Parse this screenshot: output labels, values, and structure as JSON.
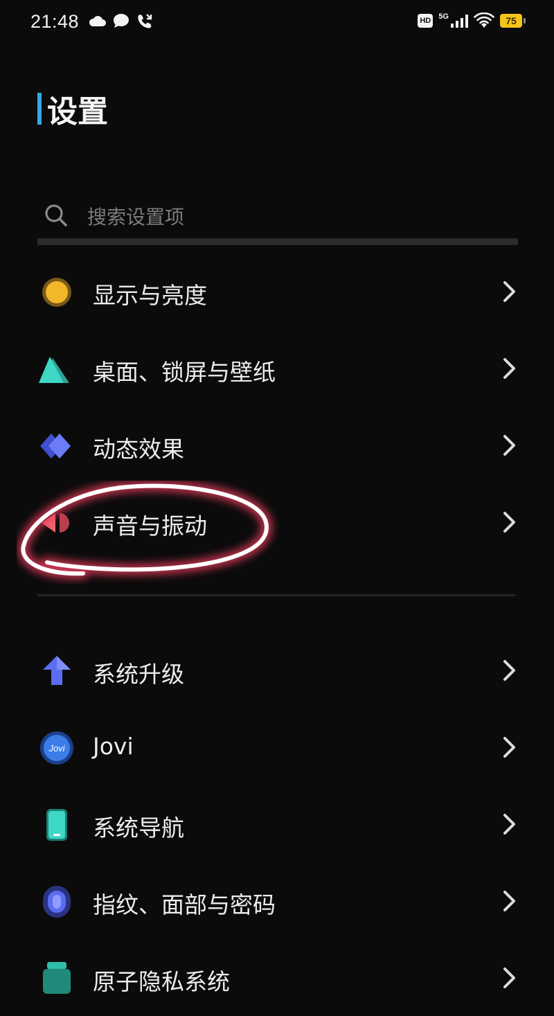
{
  "status_bar": {
    "time": "21:48",
    "network": "5G",
    "hd": "HD",
    "battery": "75",
    "icons": [
      "cloud-icon",
      "chat-icon",
      "missed-call-icon",
      "signal-icon",
      "wifi-icon"
    ]
  },
  "page": {
    "title": "设置"
  },
  "search": {
    "placeholder": "搜索设置项"
  },
  "groups": [
    [
      {
        "label": "显示与亮度",
        "icon": "display-brightness-icon",
        "color": "#f3b82a"
      },
      {
        "label": "桌面、锁屏与壁纸",
        "icon": "wallpaper-icon",
        "color": "#3fd7c6"
      },
      {
        "label": "动态效果",
        "icon": "motion-effects-icon",
        "color": "#5b6cf0"
      },
      {
        "label": "声音与振动",
        "icon": "sound-vibration-icon",
        "color": "#f0606c"
      }
    ],
    [
      {
        "label": "系统升级",
        "icon": "system-update-icon",
        "color": "#5b6cf0"
      },
      {
        "label": "Jovi",
        "icon": "jovi-icon",
        "color": "#3b7de8"
      },
      {
        "label": "系统导航",
        "icon": "navigation-icon",
        "color": "#3fd7c6"
      },
      {
        "label": "指纹、面部与密码",
        "icon": "fingerprint-icon",
        "color": "#5b6cf0"
      },
      {
        "label": "原子隐私系统",
        "icon": "privacy-icon",
        "color": "#2fbfa8"
      }
    ]
  ],
  "colors": {
    "background": "#0b0b0b",
    "accent": "#3aa6e8",
    "annotation": "#ffffff"
  }
}
